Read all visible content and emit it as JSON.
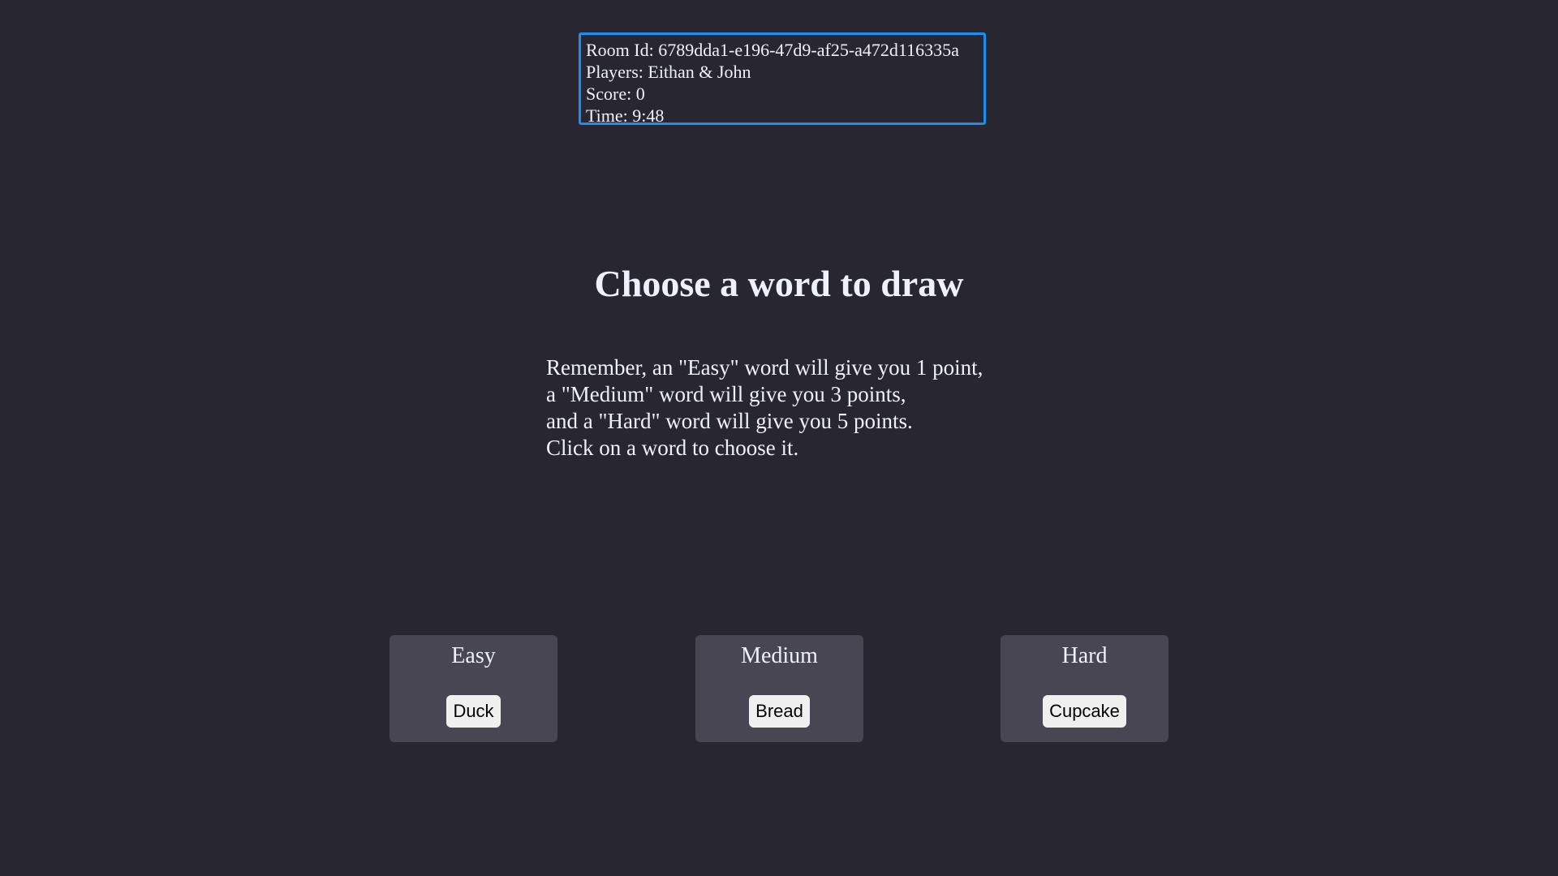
{
  "room": {
    "room_id": "Room Id: 6789dda1-e196-47d9-af25-a472d116335a",
    "players": "Players: Eithan & John",
    "score": "Score: 0",
    "time": "Time: 9:48",
    "border_color": "#1a8ff0"
  },
  "heading": "Choose a word to draw",
  "instructions": [
    "Remember, an \"Easy\" word will give you 1 point,",
    "a \"Medium\" word will give you 3 points,",
    "and a \"Hard\" word will give you 5 points.",
    "Click on a word to choose it."
  ],
  "choices": [
    {
      "difficulty": "Easy",
      "word": "Duck"
    },
    {
      "difficulty": "Medium",
      "word": "Bread"
    },
    {
      "difficulty": "Hard",
      "word": "Cupcake"
    }
  ],
  "colors": {
    "background": "#282631",
    "card": "#494654",
    "text": "#eef0fb"
  }
}
